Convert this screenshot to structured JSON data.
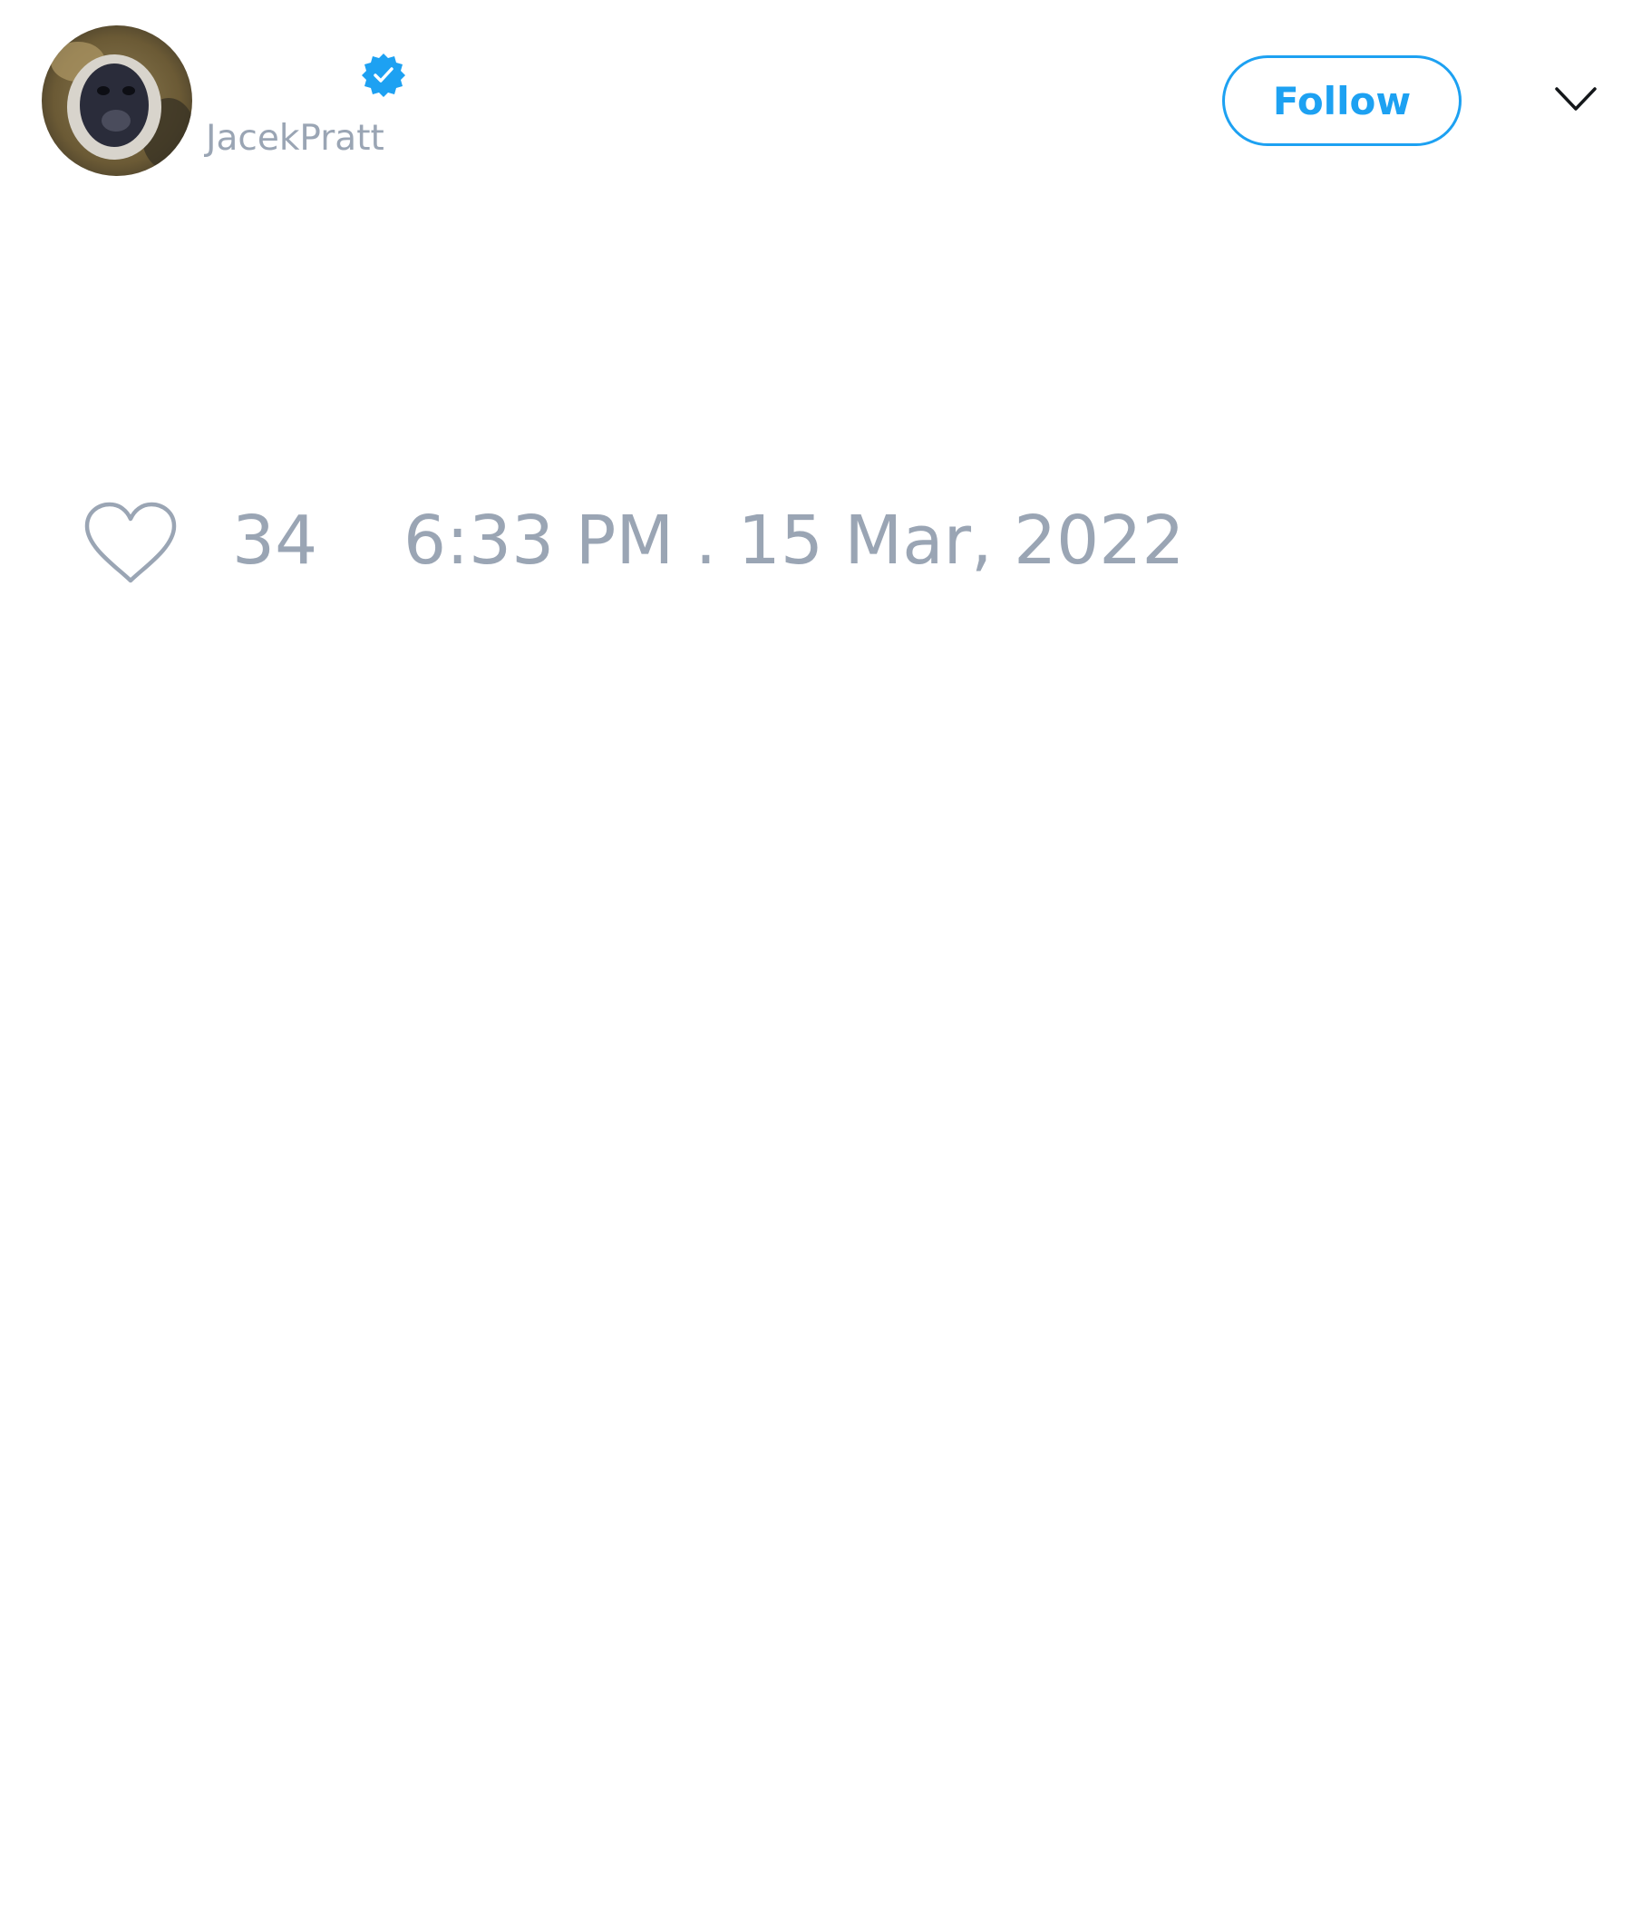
{
  "author": {
    "display_name": "",
    "handle": "JacekPratt",
    "verified": true,
    "verified_icon": "verified-badge-icon",
    "avatar_icon": "avatar-photo"
  },
  "actions": {
    "follow_label": "Follow",
    "menu_icon": "chevron-down-icon"
  },
  "engagement": {
    "like_icon": "heart-outline-icon",
    "like_count": "34"
  },
  "meta": {
    "timestamp": "6:33 PM . 15 Mar, 2022"
  },
  "colors": {
    "accent": "#1da1f2",
    "muted_text": "#9aa5b4",
    "background": "#ffffff",
    "icon_dark": "#14171a"
  }
}
